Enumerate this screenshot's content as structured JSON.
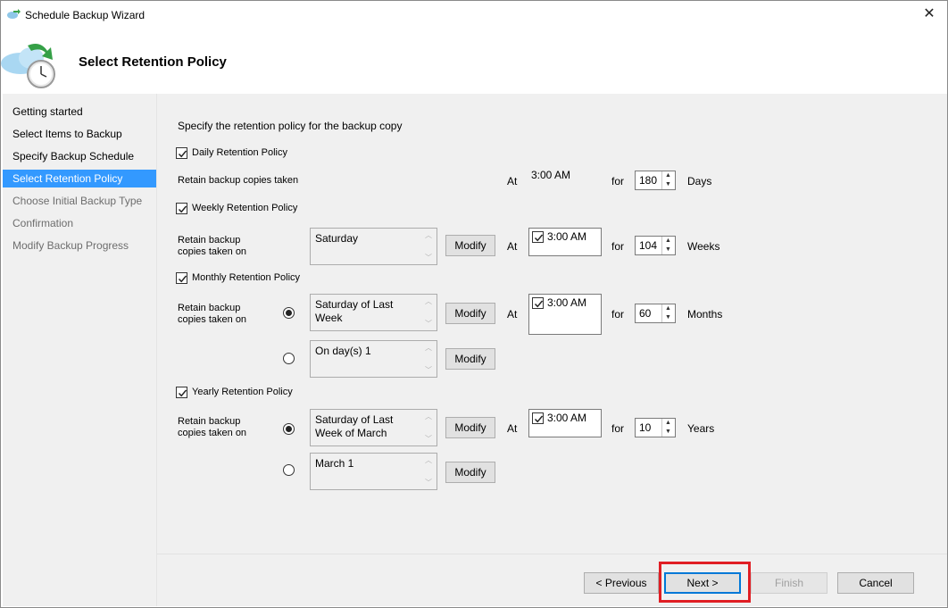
{
  "window": {
    "title": "Schedule Backup Wizard",
    "close_glyph": "✕"
  },
  "header": {
    "title": "Select Retention Policy"
  },
  "sidebar": {
    "items": [
      {
        "label": "Getting started",
        "state": "normal"
      },
      {
        "label": "Select Items to Backup",
        "state": "normal"
      },
      {
        "label": "Specify Backup Schedule",
        "state": "normal"
      },
      {
        "label": "Select Retention Policy",
        "state": "active"
      },
      {
        "label": "Choose Initial Backup Type",
        "state": "disabled"
      },
      {
        "label": "Confirmation",
        "state": "disabled"
      },
      {
        "label": "Modify Backup Progress",
        "state": "disabled"
      }
    ]
  },
  "main": {
    "intro": "Specify the retention policy for the backup copy",
    "daily": {
      "checkbox_label": "Daily Retention Policy",
      "checked": true,
      "retain_label": "Retain backup copies taken",
      "at_label": "At",
      "time": "3:00 AM",
      "for_label": "for",
      "count": "180",
      "unit": "Days"
    },
    "weekly": {
      "checkbox_label": "Weekly Retention Policy",
      "checked": true,
      "retain_label_1": "Retain backup",
      "retain_label_2": "copies taken on",
      "day": "Saturday",
      "modify_label": "Modify",
      "at_label": "At",
      "time": "3:00 AM",
      "for_label": "for",
      "count": "104",
      "unit": "Weeks"
    },
    "monthly": {
      "checkbox_label": "Monthly Retention Policy",
      "checked": true,
      "retain_label_1": "Retain backup",
      "retain_label_2": "copies taken on",
      "option1": "Saturday of Last Week",
      "option2": "On day(s) 1",
      "modify_label": "Modify",
      "at_label": "At",
      "time": "3:00 AM",
      "for_label": "for",
      "count": "60",
      "unit": "Months"
    },
    "yearly": {
      "checkbox_label": "Yearly Retention Policy",
      "checked": true,
      "retain_label_1": "Retain backup",
      "retain_label_2": "copies taken on",
      "option1": "Saturday of Last Week of March",
      "option2": "March 1",
      "modify_label": "Modify",
      "at_label": "At",
      "time": "3:00 AM",
      "for_label": "for",
      "count": "10",
      "unit": "Years"
    }
  },
  "footer": {
    "previous": "< Previous",
    "next": "Next >",
    "finish": "Finish",
    "cancel": "Cancel"
  },
  "colors": {
    "accent": "#3399ff",
    "highlight": "#e01e24"
  }
}
